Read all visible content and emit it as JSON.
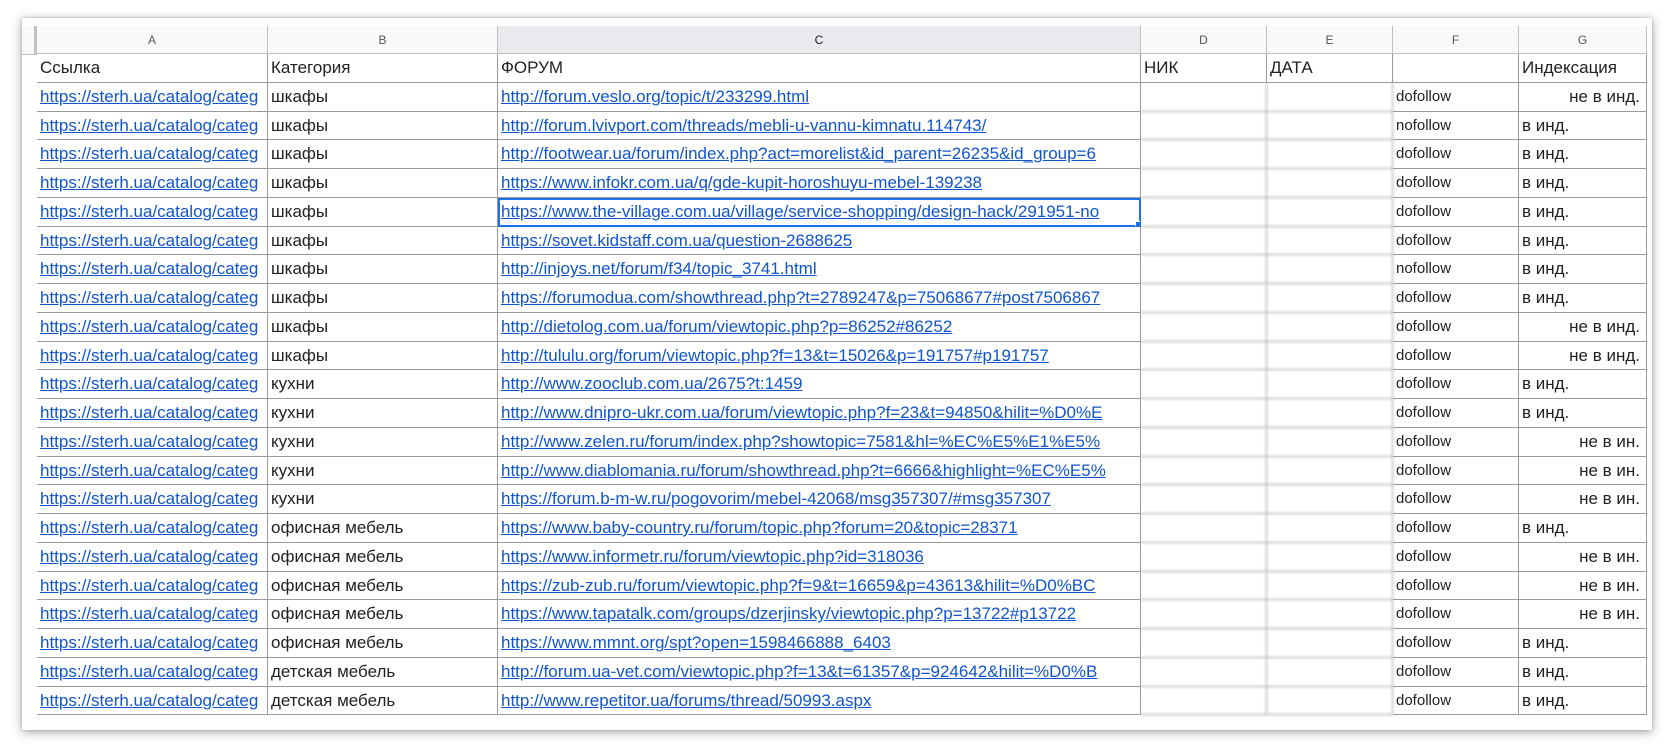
{
  "columns": [
    "A",
    "B",
    "C",
    "D",
    "E",
    "F",
    "G"
  ],
  "header_row": [
    "Ссылка",
    "Категория",
    "ФОРУМ",
    "НИК",
    "ДАТА",
    "",
    "Индексация"
  ],
  "rows": [
    {
      "a": "https://sterh.ua/catalog/categ",
      "b": "шкафы",
      "c": "http://forum.veslo.org/topic/t/233299.html",
      "d": "",
      "e": "",
      "f": "dofollow",
      "g": "не в инд.",
      "g_align": "right"
    },
    {
      "a": "https://sterh.ua/catalog/categ",
      "b": "шкафы",
      "c": "http://forum.lvivport.com/threads/mebli-u-vannu-kimnatu.114743/",
      "d": "",
      "e": "",
      "f": "nofollow",
      "g": "в инд.",
      "g_align": "left"
    },
    {
      "a": "https://sterh.ua/catalog/categ",
      "b": "шкафы",
      "c": "http://footwear.ua/forum/index.php?act=morelist&id_parent=26235&id_group=6",
      "d": "",
      "e": "",
      "f": "dofollow",
      "g": "в инд.",
      "g_align": "left"
    },
    {
      "a": "https://sterh.ua/catalog/categ",
      "b": "шкафы",
      "c": "https://www.infokr.com.ua/q/gde-kupit-horoshuyu-mebel-139238",
      "d": "",
      "e": "",
      "f": "dofollow",
      "g": "в инд.",
      "g_align": "left"
    },
    {
      "a": "https://sterh.ua/catalog/categ",
      "b": "шкафы",
      "c": "https://www.the-village.com.ua/village/service-shopping/design-hack/291951-no",
      "d": "",
      "e": "",
      "f": "dofollow",
      "g": "в инд.",
      "g_align": "left"
    },
    {
      "a": "https://sterh.ua/catalog/categ",
      "b": "шкафы",
      "c": "https://sovet.kidstaff.com.ua/question-2688625",
      "d": "",
      "e": "",
      "f": "dofollow",
      "g": "в инд.",
      "g_align": "left"
    },
    {
      "a": "https://sterh.ua/catalog/categ",
      "b": "шкафы",
      "c": "http://injoys.net/forum/f34/topic_3741.html",
      "d": "",
      "e": "",
      "f": "nofollow",
      "g": "в инд.",
      "g_align": "left"
    },
    {
      "a": "https://sterh.ua/catalog/categ",
      "b": "шкафы",
      "c": "https://forumodua.com/showthread.php?t=2789247&p=75068677#post7506867",
      "d": "",
      "e": "",
      "f": "dofollow",
      "g": "в инд.",
      "g_align": "left"
    },
    {
      "a": "https://sterh.ua/catalog/categ",
      "b": "шкафы",
      "c": "http://dietolog.com.ua/forum/viewtopic.php?p=86252#86252",
      "d": "",
      "e": "",
      "f": "dofollow",
      "g": "не в инд.",
      "g_align": "right"
    },
    {
      "a": "https://sterh.ua/catalog/categ",
      "b": "шкафы",
      "c": "http://tululu.org/forum/viewtopic.php?f=13&t=15026&p=191757#p191757",
      "d": "",
      "e": "",
      "f": "dofollow",
      "g": "не в инд.",
      "g_align": "right"
    },
    {
      "a": "https://sterh.ua/catalog/categ",
      "b": "кухни",
      "c": "http://www.zooclub.com.ua/2675?t:1459",
      "d": "",
      "e": "",
      "f": "dofollow",
      "g": "в инд.",
      "g_align": "left"
    },
    {
      "a": "https://sterh.ua/catalog/categ",
      "b": "кухни",
      "c": "http://www.dnipro-ukr.com.ua/forum/viewtopic.php?f=23&t=94850&hilit=%D0%E",
      "d": "",
      "e": "",
      "f": "dofollow",
      "g": "в инд.",
      "g_align": "left"
    },
    {
      "a": "https://sterh.ua/catalog/categ",
      "b": "кухни",
      "c": "http://www.zelen.ru/forum/index.php?showtopic=7581&hl=%EC%E5%E1%E5%",
      "d": "",
      "e": "",
      "f": "dofollow",
      "g": "не в ин.",
      "g_align": "right"
    },
    {
      "a": "https://sterh.ua/catalog/categ",
      "b": "кухни",
      "c": "http://www.diablomania.ru/forum/showthread.php?t=6666&highlight=%EC%E5%",
      "d": "",
      "e": "",
      "f": "dofollow",
      "g": "не в ин.",
      "g_align": "right"
    },
    {
      "a": "https://sterh.ua/catalog/categ",
      "b": "кухни",
      "c": "https://forum.b-m-w.ru/pogovorim/mebel-42068/msg357307/#msg357307",
      "d": "",
      "e": "",
      "f": "dofollow",
      "g": "не в ин.",
      "g_align": "right"
    },
    {
      "a": "https://sterh.ua/catalog/categ",
      "b": "офисная мебель",
      "c": "https://www.baby-country.ru/forum/topic.php?forum=20&topic=28371",
      "d": "",
      "e": "",
      "f": "dofollow",
      "g": "в инд.",
      "g_align": "left"
    },
    {
      "a": "https://sterh.ua/catalog/categ",
      "b": "офисная мебель",
      "c": "https://www.informetr.ru/forum/viewtopic.php?id=318036",
      "d": "",
      "e": "",
      "f": "dofollow",
      "g": "не в ин.",
      "g_align": "right"
    },
    {
      "a": "https://sterh.ua/catalog/categ",
      "b": "офисная мебель",
      "c": "https://zub-zub.ru/forum/viewtopic.php?f=9&t=16659&p=43613&hilit=%D0%BC",
      "d": "",
      "e": "",
      "f": "dofollow",
      "g": "не в ин.",
      "g_align": "right"
    },
    {
      "a": "https://sterh.ua/catalog/categ",
      "b": "офисная мебель",
      "c": "https://www.tapatalk.com/groups/dzerjinsky/viewtopic.php?p=13722#p13722",
      "d": "",
      "e": "",
      "f": "dofollow",
      "g": "не в ин.",
      "g_align": "right"
    },
    {
      "a": "https://sterh.ua/catalog/categ",
      "b": "офисная мебель",
      "c": "https://www.mmnt.org/spt?open=1598466888_6403",
      "d": "",
      "e": "",
      "f": "dofollow",
      "g": "в инд.",
      "g_align": "left"
    },
    {
      "a": "https://sterh.ua/catalog/categ",
      "b": "детская мебель",
      "c": "http://forum.ua-vet.com/viewtopic.php?f=13&t=61357&p=924642&hilit=%D0%B",
      "d": "",
      "e": "",
      "f": "dofollow",
      "g": "в инд.",
      "g_align": "left"
    },
    {
      "a": "https://sterh.ua/catalog/categ",
      "b": "детская мебель",
      "c": "http://www.repetitor.ua/forums/thread/50993.aspx",
      "d": "",
      "e": "",
      "f": "dofollow",
      "g": "в инд.",
      "g_align": "left"
    }
  ],
  "selected_cell": {
    "row": 4,
    "col": "c"
  }
}
